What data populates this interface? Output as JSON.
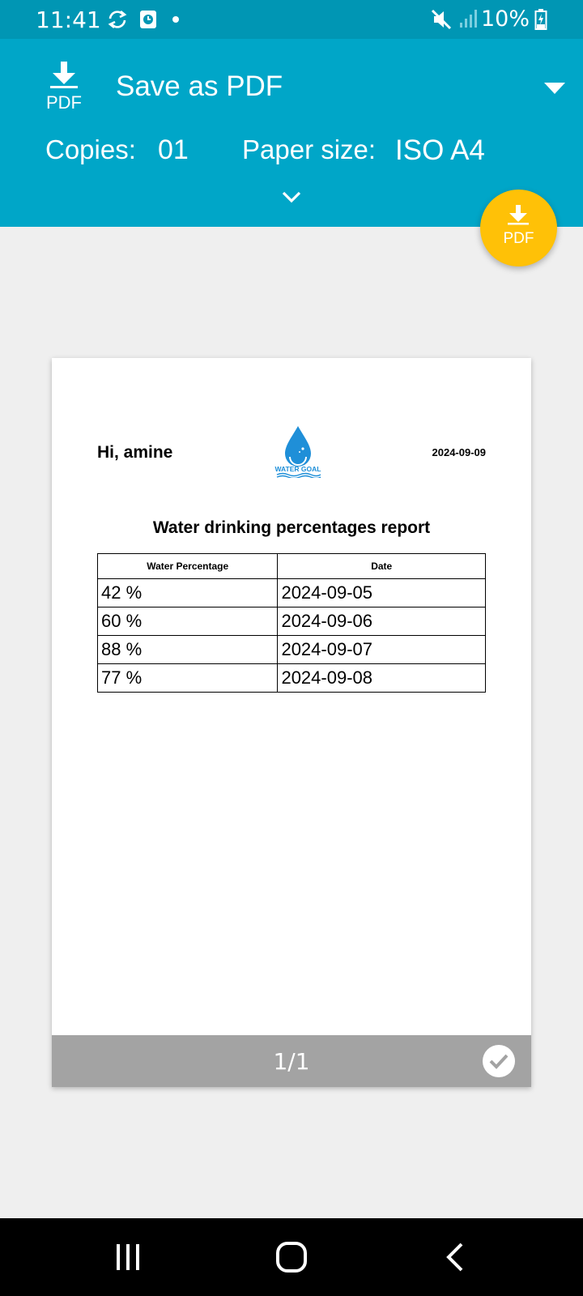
{
  "status_bar": {
    "time": "11:41",
    "battery": "10%",
    "icons": [
      "sync-icon",
      "alarm-app-icon",
      "notification-dot-icon",
      "mute-icon",
      "signal-icon",
      "battery-charging-icon"
    ]
  },
  "toolbar": {
    "destination": "Save as PDF",
    "destination_icon": "pdf-download-icon",
    "copies_label": "Copies:",
    "copies_value": "01",
    "paper_size_label": "Paper size:",
    "paper_size_value": "ISO A4",
    "accent_color": "#00a6c8"
  },
  "fab": {
    "label": "PDF",
    "icon": "download-pdf-icon",
    "color": "#ffc107"
  },
  "document": {
    "greeting": "Hi, amine",
    "date": "2024-09-09",
    "logo_text": "WATER GOAL",
    "title": "Water drinking percentages report",
    "columns": [
      "Water Percentage",
      "Date"
    ],
    "rows": [
      [
        "42 %",
        "2024-09-05"
      ],
      [
        "60 %",
        "2024-09-06"
      ],
      [
        "88 %",
        "2024-09-07"
      ],
      [
        "77 %",
        "2024-09-08"
      ]
    ]
  },
  "page_footer": {
    "page_indicator": "1/1"
  },
  "nav_bar": {
    "buttons": [
      "recent-apps-icon",
      "home-icon",
      "back-icon"
    ]
  }
}
